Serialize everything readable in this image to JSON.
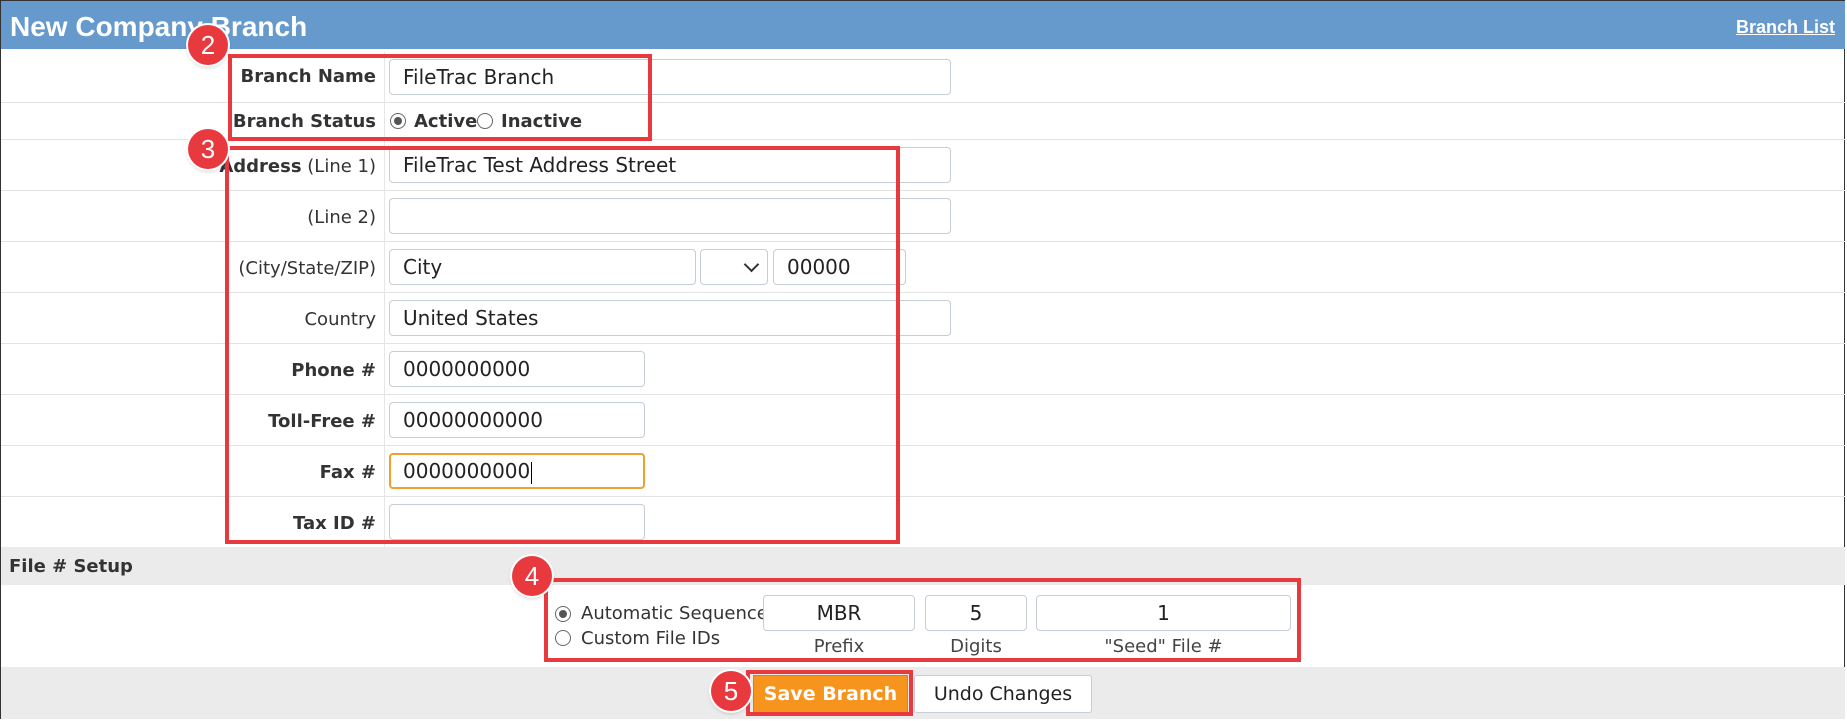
{
  "header": {
    "title": "New Company Branch",
    "link": "Branch List",
    "bg_color": "#6699cc"
  },
  "form": {
    "branch_name": {
      "label": "Branch Name",
      "value": "FileTrac Branch"
    },
    "branch_status": {
      "label": "Branch Status",
      "options": [
        "Active",
        "Inactive"
      ],
      "selected": "Active"
    },
    "address1": {
      "label_bold": "Address",
      "label_rest": " (Line 1)",
      "value": "FileTrac Test Address Street"
    },
    "address2": {
      "label": "(Line 2)",
      "value": ""
    },
    "city_state_zip": {
      "label": "(City/State/ZIP)",
      "city": "City",
      "state": "",
      "zip": "00000"
    },
    "country": {
      "label": "Country",
      "value": "United States"
    },
    "phone": {
      "label": "Phone #",
      "value": "0000000000"
    },
    "toll_free": {
      "label": "Toll-Free #",
      "value": "00000000000"
    },
    "fax": {
      "label": "Fax #",
      "value": "0000000000"
    },
    "tax_id": {
      "label": "Tax ID #",
      "value": ""
    }
  },
  "file_setup": {
    "section_title": "File # Setup",
    "options": [
      "Automatic Sequence",
      "Custom File IDs"
    ],
    "selected": "Automatic Sequence",
    "prefix": {
      "value": "MBR",
      "label": "Prefix"
    },
    "digits": {
      "value": "5",
      "label": "Digits"
    },
    "seed": {
      "value": "1",
      "label": "\"Seed\" File #"
    }
  },
  "actions": {
    "save": "Save Branch",
    "undo": "Undo Changes",
    "save_color": "#f7941d"
  },
  "annotations": [
    "2",
    "3",
    "4",
    "5"
  ],
  "annotation_color": "#e8393e"
}
